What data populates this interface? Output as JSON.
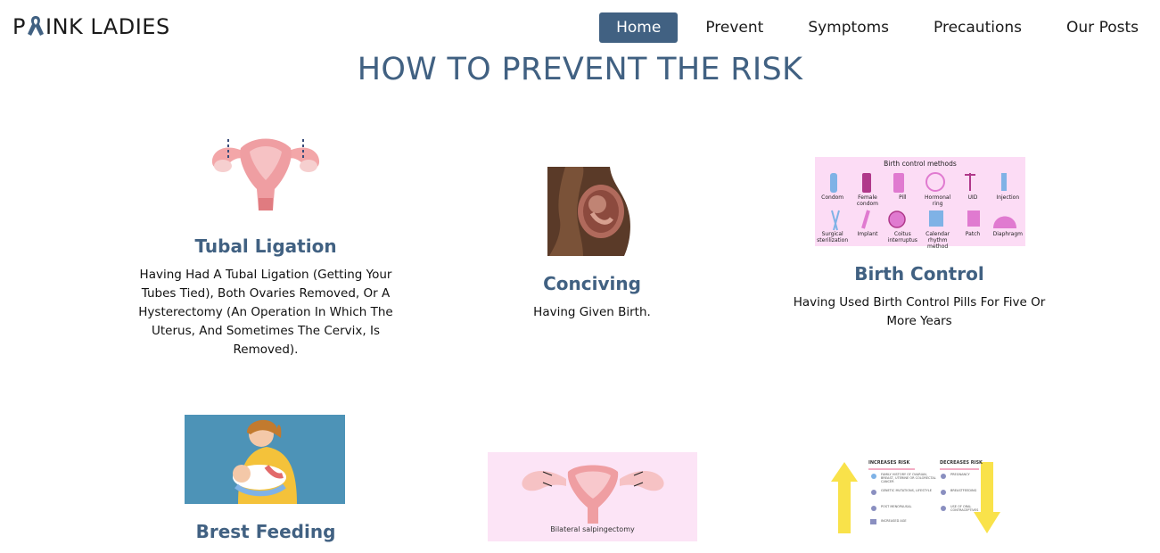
{
  "brand": {
    "name_prefix": "P",
    "name_suffix": "INK LADIES",
    "ribbon_color": "#416182"
  },
  "nav": {
    "items": [
      {
        "label": "Home",
        "active": true
      },
      {
        "label": "Prevent"
      },
      {
        "label": "Symptoms"
      },
      {
        "label": "Precautions"
      },
      {
        "label": "Our Posts"
      }
    ]
  },
  "page_title": "HOW TO PREVENT THE RISK",
  "cards": [
    {
      "title": "Tubal Ligation",
      "text": "Having Had A Tubal Ligation (Getting Your Tubes Tied), Both Ovaries Removed, Or A Hysterectomy (An Operation In Which The Uterus, And Sometimes The Cervix, Is Removed)."
    },
    {
      "title": "Conciving",
      "text": "Having Given Birth."
    },
    {
      "title": "Birth Control",
      "text": "Having Used Birth Control Pills For Five Or More Years"
    },
    {
      "title": "Brest Feeding"
    }
  ],
  "birth_control_image": {
    "heading": "Birth control methods",
    "methods_row1": [
      "Condom",
      "Female condom",
      "Pill",
      "Hormonal ring",
      "UID",
      "Injection"
    ],
    "methods_row2": [
      "Surgical sterilization",
      "Implant",
      "Coitus interruptus",
      "Calendar rhythm method",
      "Patch",
      "Diaphragm"
    ]
  },
  "salpingectomy_image": {
    "caption": "Bilateral salpingectomy"
  },
  "risk_image": {
    "increases_heading": "INCREASES RISK",
    "decreases_heading": "DECREASES RISK",
    "increases_items": [
      "FAMILY HISTORY OF OVARIAN, BREAST, UTERINE OR COLORECTAL CANCER",
      "GENETIC MUTATIONS, LIFESTYLE",
      "POST MENOPAUSAL",
      "INCREASED AGE"
    ],
    "decreases_items": [
      "PREGNANCY",
      "BREASTFEEDING",
      "USE OF ORAL CONTRACEPTIVES"
    ]
  },
  "colors": {
    "accent": "#416182",
    "pink_bg": "#fce4f6",
    "blue_bg": "#4d93b7"
  }
}
